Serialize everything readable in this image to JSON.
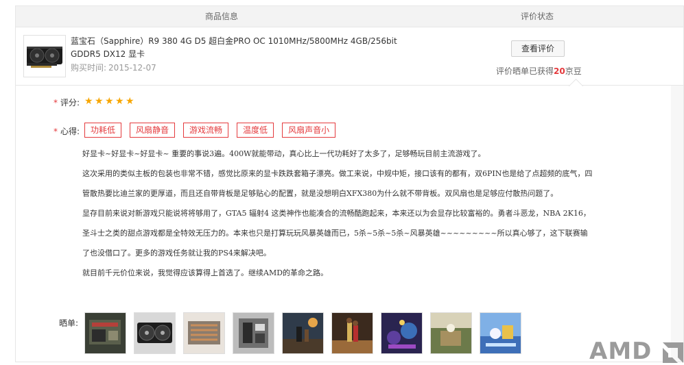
{
  "header": {
    "col_product": "商品信息",
    "col_status": "评价状态"
  },
  "product": {
    "title": "蓝宝石（Sapphire）R9 380 4G D5 超白金PRO OC 1010MHz/5800MHz 4GB/256bit GDDR5 DX12 显卡",
    "purchase_label": "购买时间:",
    "purchase_date": "2015-12-07"
  },
  "status": {
    "view_button": "查看评价",
    "beans_prefix": "评价晒单已获得",
    "beans_count": "20",
    "beans_suffix": "京豆"
  },
  "review": {
    "rating_label": "评分:",
    "rating": 5,
    "feeling_label": "心得:",
    "tags": [
      "功耗低",
      "风扇静音",
      "游戏流畅",
      "温度低",
      "风扇声音小"
    ],
    "paragraphs": [
      "好显卡~好显卡~好显卡~ 重要的事说3遍。400W就能带动，真心比上一代功耗好了太多了，足够畅玩目前主流游戏了。",
      "这次采用的类似主板的包装也非常不错，感觉比原来的显卡跌跌套箱子漂亮。做工来说，中规中矩，接口该有的都有，双6PIN也是给了点超频的底气，四管散热要比迪兰家的更厚道，而且还自带背板是足够贴心的配置，就是没想明白XFX380为什么就不带背板。双风扇也是足够应付散热问题了。",
      "显存目前来说对新游戏只能说将将够用了，GTA5 辐射4 这类神作也能凑合的流畅酷跑起来，本来还以为会显存比较富裕的。勇者斗恶龙，NBA 2K16，圣斗士之类的甜点游戏都是全特效无压力的。本来也只是打算玩玩风暴英雄而已，5杀~5杀~5杀~风暴英雄~~~~~~~~~所以真心够了，这下联赛输了也没借口了。更多的游戏任务就让我的PS4来解决吧。",
      "就目前千元价位来说，我觉得应该算得上首选了。继续AMD的革命之路。"
    ],
    "photos_label": "晒单:"
  },
  "watermark": {
    "text": "AMD"
  },
  "colors": {
    "accent_red": "#e4393c",
    "star": "#f7a600",
    "watermark": "#9b9b9b"
  }
}
